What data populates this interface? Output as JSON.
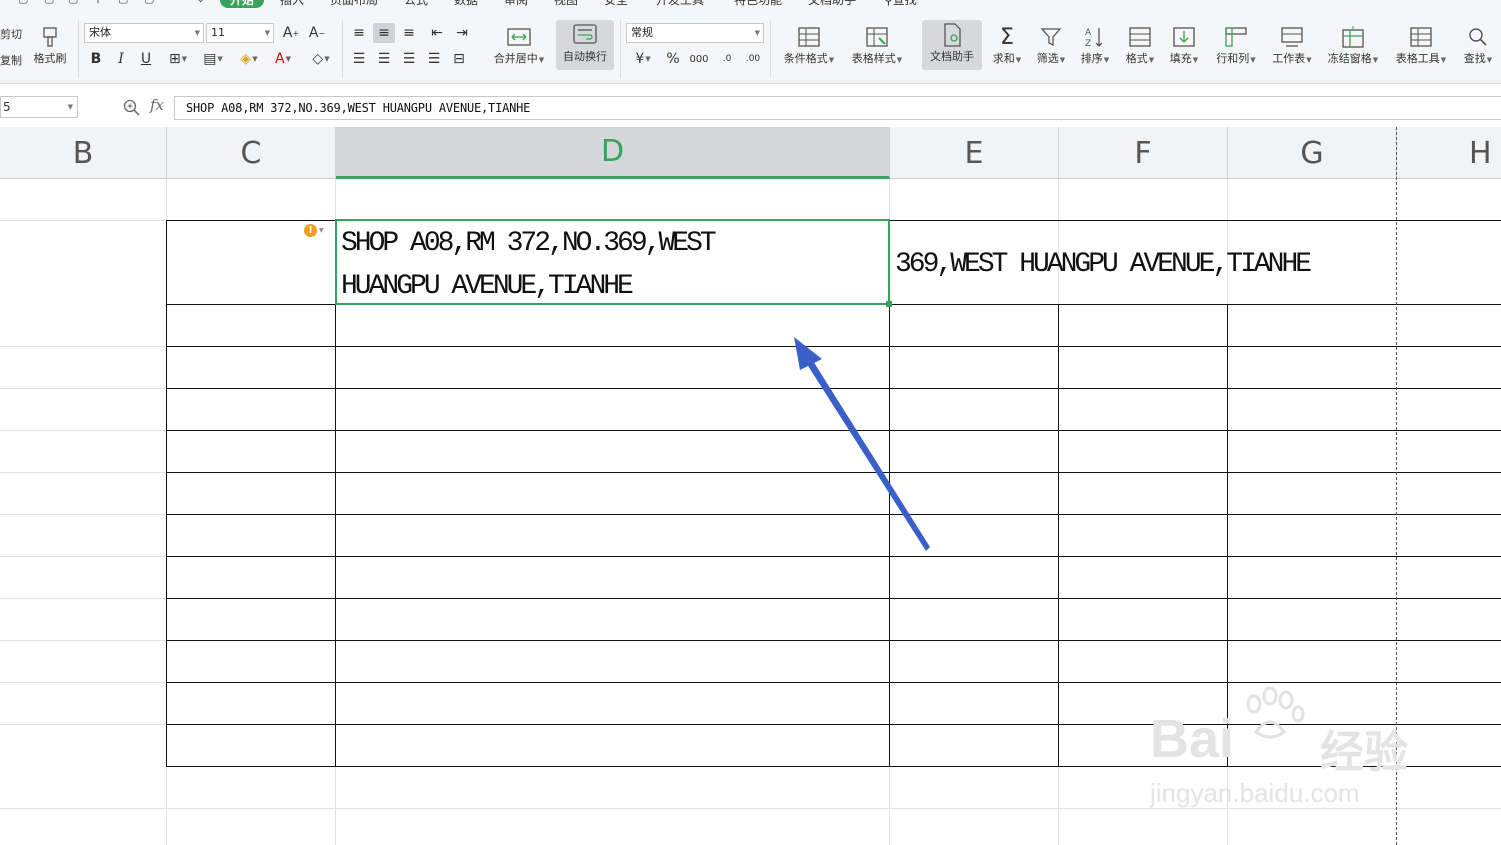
{
  "menu": {
    "tabs": [
      {
        "label": "开始",
        "active": true
      },
      {
        "label": "插入"
      },
      {
        "label": "页面布局"
      },
      {
        "label": "公式"
      },
      {
        "label": "数据"
      },
      {
        "label": "审阅"
      },
      {
        "label": "视图"
      },
      {
        "label": "安全"
      },
      {
        "label": "开发工具"
      },
      {
        "label": "特色功能"
      },
      {
        "label": "文档助手"
      }
    ],
    "search_label": "查找"
  },
  "ribbon": {
    "clipboard": {
      "cut": "剪切",
      "copy": "复制",
      "format_painter": "格式刷"
    },
    "font": {
      "name": "宋体",
      "size": "11"
    },
    "merge_center": "合并居中",
    "wrap_text": "自动换行",
    "number_format": "常规",
    "buttons": [
      {
        "label": "条件格式"
      },
      {
        "label": "表格样式"
      },
      {
        "label": "文档助手"
      },
      {
        "label": "求和"
      },
      {
        "label": "筛选"
      },
      {
        "label": "排序"
      },
      {
        "label": "格式"
      },
      {
        "label": "填充"
      },
      {
        "label": "行和列"
      },
      {
        "label": "工作表"
      },
      {
        "label": "冻结窗格"
      },
      {
        "label": "表格工具"
      },
      {
        "label": "查找"
      }
    ]
  },
  "formula_bar": {
    "name_box": "5",
    "fx": "fx",
    "content": "SHOP A08,RM 372,NO.369,WEST HUANGPU AVENUE,TIANHE"
  },
  "sheet": {
    "columns": [
      "B",
      "C",
      "D",
      "E",
      "F",
      "G",
      "H"
    ],
    "selected_column": "D",
    "cell_d_line1": "SHOP A08,RM 372,NO.369,WEST",
    "cell_d_line2": "HUANGPU AVENUE,TIANHE",
    "cell_e_overflow": "369,WEST HUANGPU AVENUE,TIANHE"
  },
  "watermark": {
    "brand": "Bai",
    "brand_cn": "经验",
    "site": "jingyan.baidu.com"
  },
  "colors": {
    "accent": "#3aa35b",
    "arrow": "#3b5fc8",
    "warning": "#f0a020"
  }
}
